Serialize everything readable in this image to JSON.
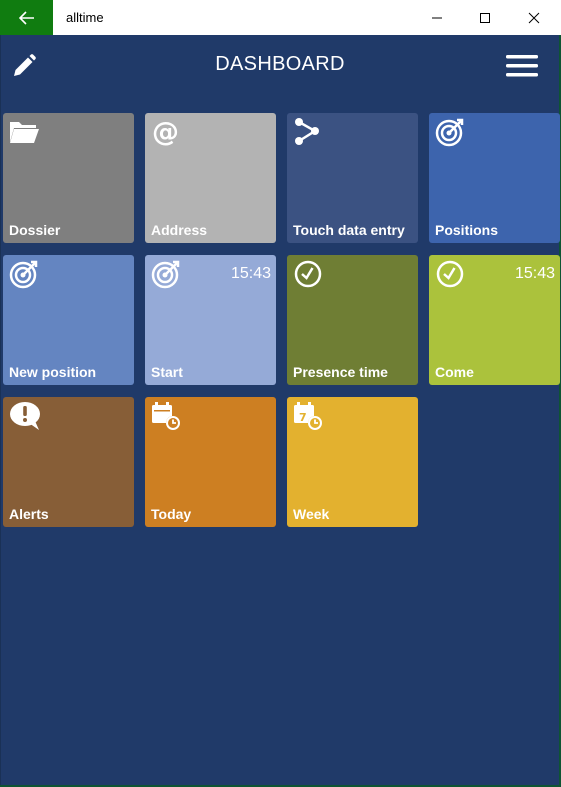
{
  "window": {
    "title": "alltime",
    "back_icon": "back-arrow-icon",
    "minimize_icon": "minimize-icon",
    "maximize_icon": "maximize-icon",
    "close_icon": "close-icon",
    "back_color": "#107c10"
  },
  "header": {
    "title": "DASHBOARD",
    "edit_icon": "pencil-icon",
    "menu_icon": "hamburger-menu-icon"
  },
  "colors": {
    "background": "#203a69"
  },
  "tiles": [
    {
      "label": "Dossier",
      "icon": "folder-icon",
      "color": "#7f7f7f",
      "time": ""
    },
    {
      "label": "Address",
      "icon": "at-sign-icon",
      "color": "#b3b3b3",
      "time": ""
    },
    {
      "label": "Touch data entry",
      "icon": "share-nodes-icon",
      "color": "#3b5282",
      "time": ""
    },
    {
      "label": "Positions",
      "icon": "target-icon",
      "color": "#3d64ad",
      "time": ""
    },
    {
      "label": "New position",
      "icon": "target-icon",
      "color": "#6485c1",
      "time": ""
    },
    {
      "label": "Start",
      "icon": "target-icon",
      "color": "#95aad7",
      "time": "15:43"
    },
    {
      "label": "Presence time",
      "icon": "clock-icon",
      "color": "#6f7e34",
      "time": ""
    },
    {
      "label": "Come",
      "icon": "clock-icon",
      "color": "#abc23c",
      "time": "15:43"
    },
    {
      "label": "Alerts",
      "icon": "alert-bubble-icon",
      "color": "#875e37",
      "time": ""
    },
    {
      "label": "Today",
      "icon": "calendar-clock-icon",
      "color": "#cd7f22",
      "time": ""
    },
    {
      "label": "Week",
      "icon": "calendar-week-icon",
      "color": "#e3b12f",
      "time": ""
    }
  ]
}
